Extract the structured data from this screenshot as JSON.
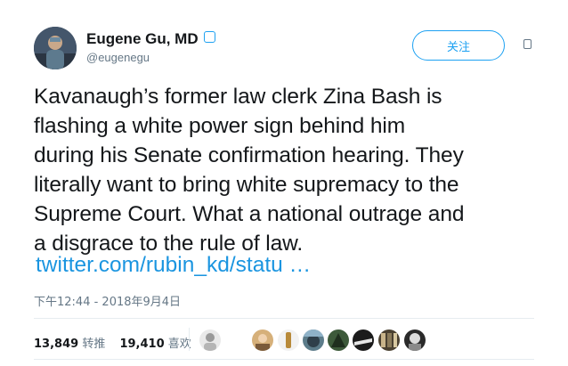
{
  "user": {
    "name": "Eugene Gu, MD",
    "handle": "@eugenegu"
  },
  "follow_label": "关注",
  "tweet": {
    "lines": [
      "Kavanaugh’s former law clerk Zina Bash is",
      "flashing a white power sign behind him",
      "during his Senate confirmation hearing. They",
      "literally want to bring white supremacy to the",
      "Supreme Court. What a national outrage and",
      "a disgrace to the rule of law."
    ],
    "link": "twitter.com/rubin_kd/statu …"
  },
  "timestamp": "下午12:44 - 2018年9月4日",
  "stats": {
    "retweets": "13,849",
    "retweets_label": "转推",
    "likes": "19,410",
    "likes_label": "喜欢"
  },
  "colors": {
    "accent": "#1da1f2",
    "link": "#1b95e0",
    "muted": "#657786",
    "divider": "#e6ecf0"
  },
  "icons": {
    "verified": "verified-badge-icon",
    "more": "caret-down-icon"
  }
}
